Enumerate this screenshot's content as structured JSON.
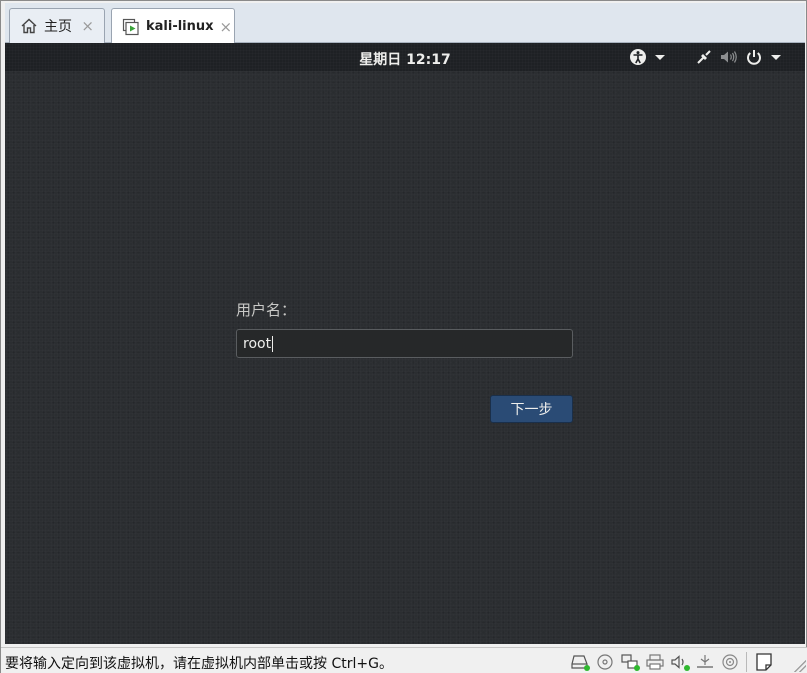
{
  "tabs": [
    {
      "label": "主页",
      "icon": "home-icon"
    },
    {
      "label": "kali-linux",
      "icon": "vm-play-icon"
    }
  ],
  "tab_close_glyph": "×",
  "guest": {
    "clock": "星期日 12:17",
    "login": {
      "username_label": "用户名：",
      "username_value": "root",
      "next_button": "下一步"
    }
  },
  "statusbar": {
    "message": "要将输入定向到该虚拟机，请在虚拟机内部单击或按 Ctrl+G。",
    "devices": [
      "hard-disk-icon",
      "cd-dvd-icon",
      "network-adapter-icon",
      "printer-icon",
      "sound-card-icon",
      "usb-icon",
      "display-icon"
    ]
  },
  "colors": {
    "guest_background": "#2b2e31",
    "top_panel": "#1e2124",
    "next_button": "#2a4b75",
    "device_active": "#2fb82f"
  }
}
